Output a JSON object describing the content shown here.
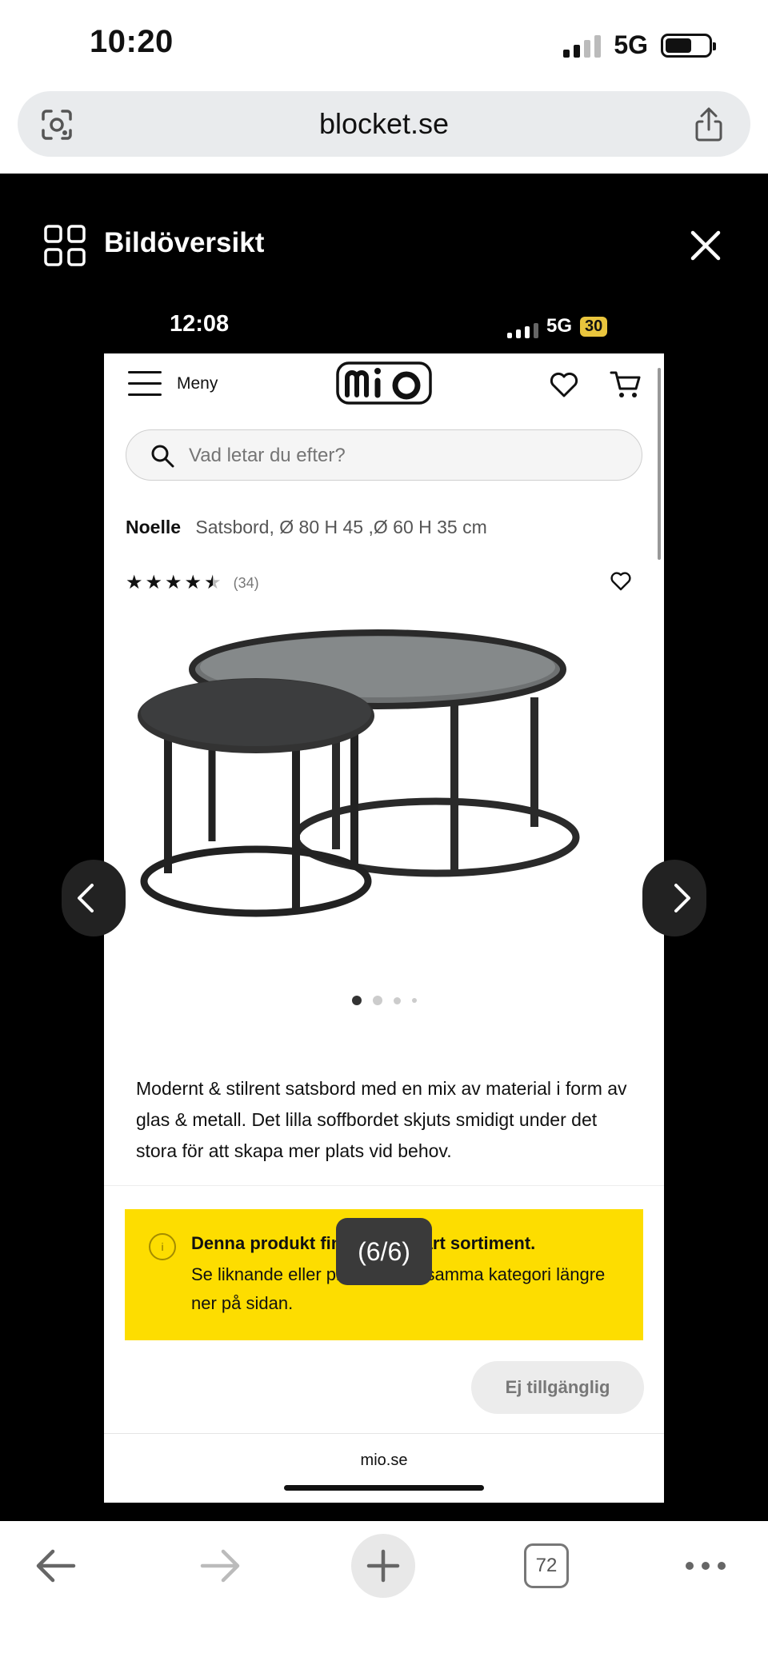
{
  "os_status": {
    "time": "10:20",
    "network": "5G"
  },
  "browser": {
    "url": "blocket.se"
  },
  "gallery": {
    "title": "Bildöversikt",
    "counter": "(6/6)"
  },
  "screenshot_status": {
    "time": "12:08",
    "network": "5G",
    "battery": "30"
  },
  "mio": {
    "menu_label": "Meny",
    "logo_text": "mio",
    "search_placeholder": "Vad letar du efter?",
    "product_name": "Noelle",
    "product_subtitle": "Satsbord, Ø 80 H 45 ,Ø 60 H 35 cm",
    "rating_stars": 4.5,
    "review_count": "(34)",
    "description": "Modernt & stilrent satsbord med en mix av material i form av glas & metall. Det lilla soffbordet skjuts smidigt under det stora för att skapa mer plats vid behov.",
    "notice_title": "Denna produkt finns inte i vårt sortiment.",
    "notice_body": "Se liknande eller produkter ur samma kategori längre ner på sidan.",
    "unavailable_label": "Ej tillgänglig",
    "footer_domain": "mio.se",
    "carousel": {
      "count": 4,
      "active": 0
    }
  },
  "toolbar": {
    "tab_count": "72"
  },
  "colors": {
    "notice_bg": "#fddd00",
    "overlay_bg": "#000000"
  }
}
